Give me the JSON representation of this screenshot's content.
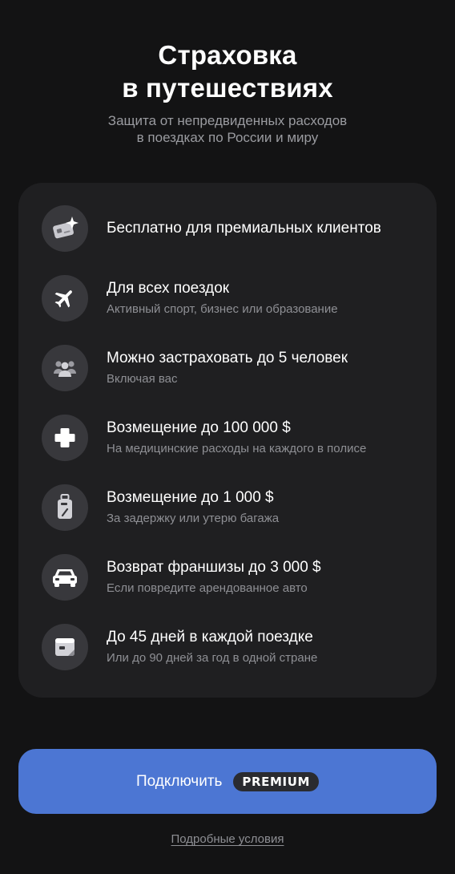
{
  "header": {
    "title_line1": "Страховка",
    "title_line2": "в путешествиях",
    "subtitle_line1": "Защита от непредвиденных расходов",
    "subtitle_line2": "в поездках по России и миру"
  },
  "features": [
    {
      "icon": "premium-card-sparkle-icon",
      "title": "Бесплатно для премиальных клиентов",
      "subtitle": ""
    },
    {
      "icon": "airplane-icon",
      "title": "Для всех поездок",
      "subtitle": "Активный спорт, бизнес или образование"
    },
    {
      "icon": "people-group-icon",
      "title": "Можно застраховать до 5 человек",
      "subtitle": "Включая вас"
    },
    {
      "icon": "medical-cross-icon",
      "title": "Возмещение до 100 000 $",
      "subtitle": "На медицинские расходы на каждого в полисе"
    },
    {
      "icon": "luggage-tag-icon",
      "title": "Возмещение до 1 000 $",
      "subtitle": "За задержку или утерю багажа"
    },
    {
      "icon": "car-icon",
      "title": "Возврат франшизы до 3 000 $",
      "subtitle": "Если повредите арендованное авто"
    },
    {
      "icon": "calendar-days-icon",
      "title": "До 45 дней в каждой поездке",
      "subtitle": "Или до 90 дней за год в одной стране"
    }
  ],
  "cta": {
    "label": "Подключить",
    "badge": "PREMIUM"
  },
  "terms_link": "Подробные условия",
  "colors": {
    "background": "#131314",
    "card": "#1f1f21",
    "icon_circle": "#38383c",
    "accent_button": "#4c76d3",
    "badge": "#2a2b30",
    "muted_text": "#8e8f94"
  }
}
